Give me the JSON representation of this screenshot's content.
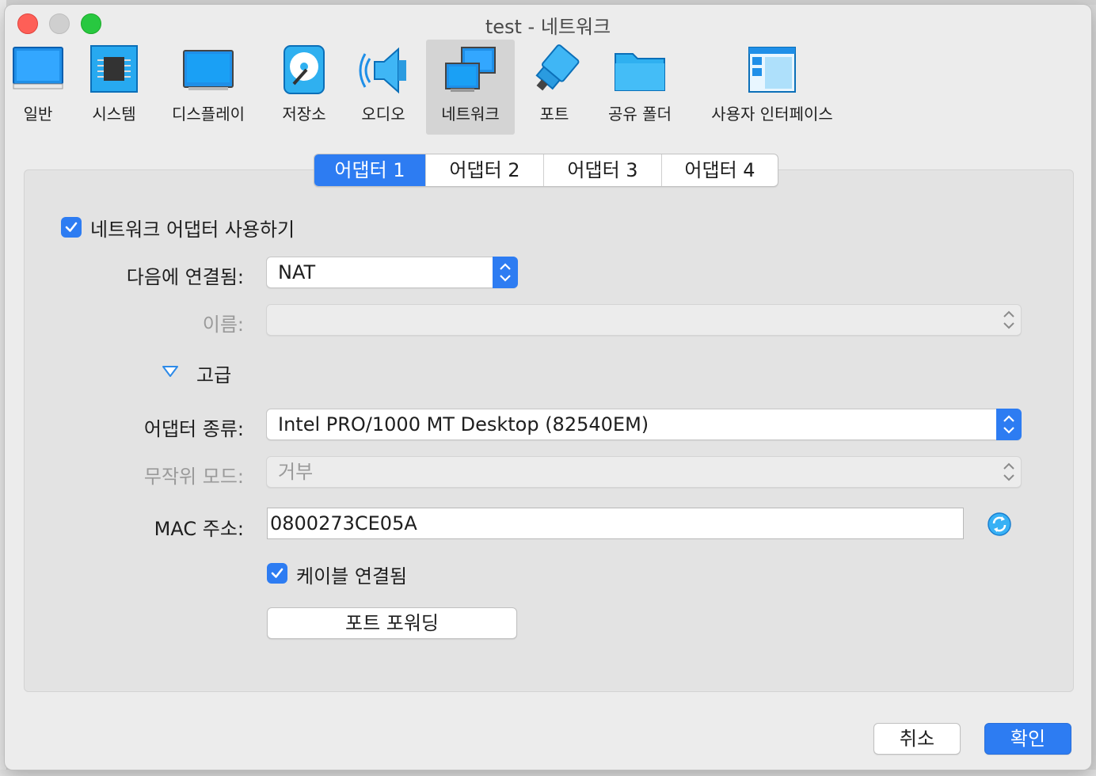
{
  "window": {
    "title": "test - 네트워크"
  },
  "toolbar": {
    "items": [
      {
        "label": "일반",
        "icon": "general-icon"
      },
      {
        "label": "시스템",
        "icon": "system-icon"
      },
      {
        "label": "디스플레이",
        "icon": "display-icon"
      },
      {
        "label": "저장소",
        "icon": "storage-icon"
      },
      {
        "label": "오디오",
        "icon": "audio-icon"
      },
      {
        "label": "네트워크",
        "icon": "network-icon",
        "selected": true
      },
      {
        "label": "포트",
        "icon": "ports-icon"
      },
      {
        "label": "공유 폴더",
        "icon": "shared-folder-icon"
      },
      {
        "label": "사용자 인터페이스",
        "icon": "user-interface-icon"
      }
    ]
  },
  "tabs": [
    {
      "label": "어댑터 1",
      "active": true
    },
    {
      "label": "어댑터 2"
    },
    {
      "label": "어댑터 3"
    },
    {
      "label": "어댑터 4"
    }
  ],
  "form": {
    "enable_adapter_label": "네트워크 어댑터 사용하기",
    "attached_to_label": "다음에 연결됨:",
    "attached_to_value": "NAT",
    "name_label": "이름:",
    "name_value": "",
    "advanced_label": "고급",
    "adapter_type_label": "어댑터 종류:",
    "adapter_type_value": "Intel PRO/1000 MT Desktop (82540EM)",
    "promiscuous_label": "무작위 모드:",
    "promiscuous_value": "거부",
    "mac_label": "MAC 주소:",
    "mac_value": "0800273CE05A",
    "cable_connected_label": "케이블 연결됨",
    "port_forwarding_label": "포트 포워딩"
  },
  "footer": {
    "cancel_label": "취소",
    "ok_label": "확인"
  },
  "colors": {
    "accent": "#2d7cf2",
    "window_bg": "#ececec",
    "panel_bg": "#e3e3e3"
  }
}
